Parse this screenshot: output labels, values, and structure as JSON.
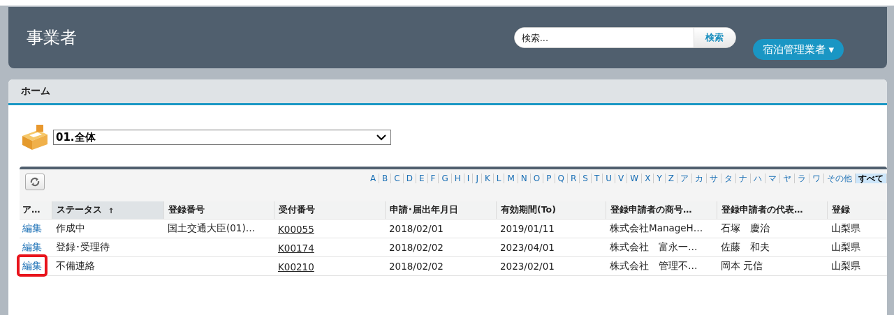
{
  "header": {
    "title": "事業者",
    "search": {
      "placeholder": "検索...",
      "button": "検索"
    },
    "user_menu": "宿泊管理業者 ▾"
  },
  "tab": {
    "title": "ホーム"
  },
  "view_select": {
    "value": "01.全体"
  },
  "alphabet": [
    {
      "label": "A",
      "selected": false
    },
    {
      "label": "B",
      "selected": false
    },
    {
      "label": "C",
      "selected": false
    },
    {
      "label": "D",
      "selected": false
    },
    {
      "label": "E",
      "selected": false
    },
    {
      "label": "F",
      "selected": false
    },
    {
      "label": "G",
      "selected": false
    },
    {
      "label": "H",
      "selected": false
    },
    {
      "label": "I",
      "selected": false
    },
    {
      "label": "J",
      "selected": false
    },
    {
      "label": "K",
      "selected": false
    },
    {
      "label": "L",
      "selected": false
    },
    {
      "label": "M",
      "selected": false
    },
    {
      "label": "N",
      "selected": false
    },
    {
      "label": "O",
      "selected": false
    },
    {
      "label": "P",
      "selected": false
    },
    {
      "label": "Q",
      "selected": false
    },
    {
      "label": "R",
      "selected": false
    },
    {
      "label": "S",
      "selected": false
    },
    {
      "label": "T",
      "selected": false
    },
    {
      "label": "U",
      "selected": false
    },
    {
      "label": "V",
      "selected": false
    },
    {
      "label": "W",
      "selected": false
    },
    {
      "label": "X",
      "selected": false
    },
    {
      "label": "Y",
      "selected": false
    },
    {
      "label": "Z",
      "selected": false
    },
    {
      "label": "ア",
      "selected": false
    },
    {
      "label": "カ",
      "selected": false
    },
    {
      "label": "サ",
      "selected": false
    },
    {
      "label": "タ",
      "selected": false
    },
    {
      "label": "ナ",
      "selected": false
    },
    {
      "label": "ハ",
      "selected": false
    },
    {
      "label": "マ",
      "selected": false
    },
    {
      "label": "ヤ",
      "selected": false
    },
    {
      "label": "ラ",
      "selected": false
    },
    {
      "label": "ワ",
      "selected": false
    },
    {
      "label": "その他",
      "selected": false
    },
    {
      "label": "すべて",
      "selected": true
    }
  ],
  "table": {
    "columns": [
      {
        "label": "ア…"
      },
      {
        "label": "ステータス",
        "sort_mark": "↑"
      },
      {
        "label": "登録番号"
      },
      {
        "label": "受付番号"
      },
      {
        "label": "申請･届出年月日"
      },
      {
        "label": "有効期間(To)"
      },
      {
        "label": "登録申請者の商号…"
      },
      {
        "label": "登録申請者の代表…"
      },
      {
        "label": "登録"
      }
    ],
    "rows": [
      {
        "highlighted": false,
        "cells": [
          "編集",
          "作成中",
          "国土交通大臣(01)…",
          "K00055",
          "2018/02/01",
          "2019/01/11",
          "株式会社ManageH…",
          "石塚　慶治",
          "山梨県"
        ]
      },
      {
        "highlighted": false,
        "cells": [
          "編集",
          "登録･受理待",
          "",
          "K00174",
          "2018/02/02",
          "2023/04/01",
          "株式会社　富永一…",
          "佐藤　和夫",
          "山梨県"
        ]
      },
      {
        "highlighted": true,
        "cells": [
          "編集",
          "不備連絡",
          "",
          "K00210",
          "2018/02/02",
          "2023/02/01",
          "株式会社　管理不…",
          "岡本 元信",
          "山梨県"
        ]
      }
    ]
  }
}
